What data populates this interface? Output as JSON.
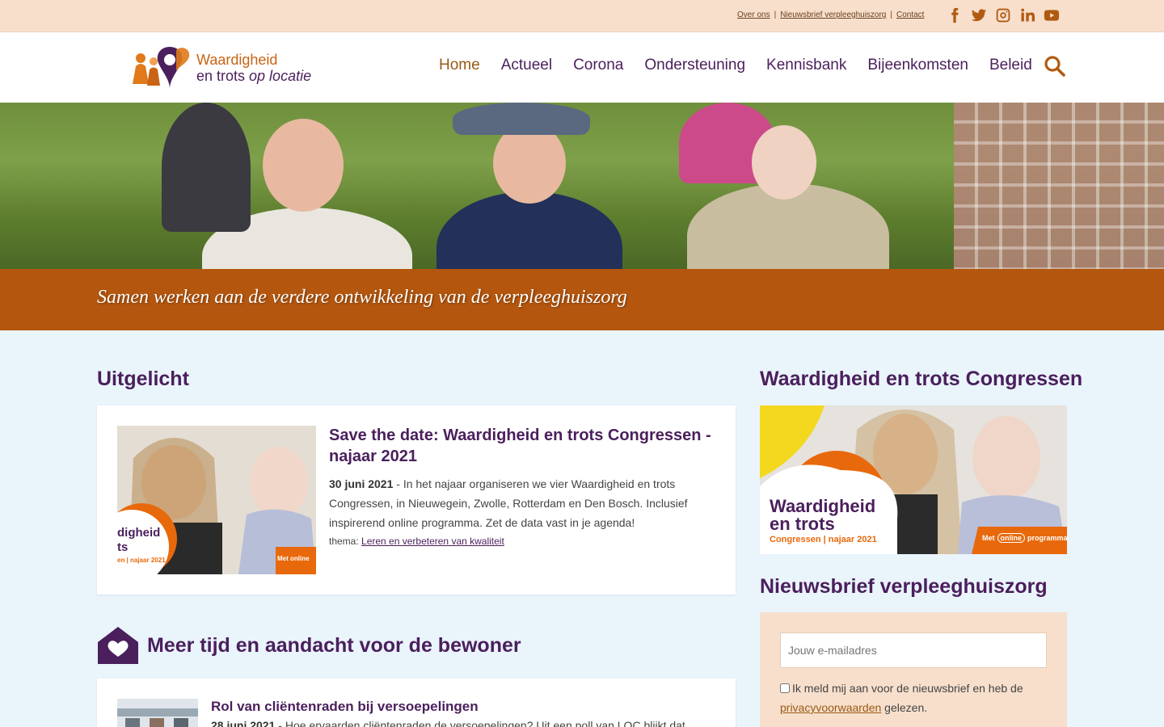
{
  "topbar": {
    "links": [
      "Over ons",
      "Nieuwsbrief verpleeghuiszorg",
      "Contact"
    ],
    "separator": "|",
    "social": [
      "facebook-icon",
      "twitter-icon",
      "instagram-icon",
      "linkedin-icon",
      "youtube-icon"
    ]
  },
  "logo": {
    "line1": "Waardigheid",
    "line2a": "en trots ",
    "line2b": "op locatie"
  },
  "nav": [
    "Home",
    "Actueel",
    "Corona",
    "Ondersteuning",
    "Kennisbank",
    "Bijeenkomsten",
    "Beleid"
  ],
  "hero": {
    "tagline": "Samen werken aan de verdere ontwikkeling van de verpleeghuiszorg"
  },
  "featured": {
    "heading": "Uitgelicht",
    "title": "Save the date: Waardigheid en trots Congressen - najaar 2021",
    "date": "30 juni 2021",
    "summary": " - In het najaar organiseren we vier Waardigheid en trots Congressen, in Nieuwegein, Zwolle, Rotterdam en Den Bosch. Inclusief inspirerend online programma. Zet de data vast in je agenda!",
    "theme_label": "thema: ",
    "theme_link": "Leren en verbeteren van kwaliteit",
    "thumb_text1": "digheid",
    "thumb_text2": "ts",
    "thumb_text3": "en | najaar 2021",
    "thumb_badge": "Met online"
  },
  "section2": {
    "heading": "Meer tijd en aandacht voor de bewoner",
    "title": "Rol van cliëntenraden bij versoepelingen",
    "date": "28 juni 2021",
    "summary": " - Hoe ervaarden cliëntenraden de versoepelingen? Uit een poll van LOC blijkt dat"
  },
  "sidebar": {
    "congress_heading": "Waardigheid en trots Congressen",
    "promo_line1": "Waardigheid",
    "promo_line2": "en trots",
    "promo_line3": "Congressen | najaar 2021",
    "promo_badge_pre": "Met",
    "promo_badge_online": "online",
    "promo_badge_post": "programma",
    "newsletter_heading": "Nieuwsbrief verpleeghuiszorg",
    "email_placeholder": "Jouw e-mailadres",
    "consent_text": "Ik meld mij aan voor de nieuwsbrief en heb de ",
    "consent_link": "privacyvoorwaarden",
    "consent_after": " gelezen."
  },
  "colors": {
    "purple": "#4a1f5c",
    "orange": "#b4560e",
    "peach": "#f7dfcc",
    "background": "#eaf4fb"
  }
}
